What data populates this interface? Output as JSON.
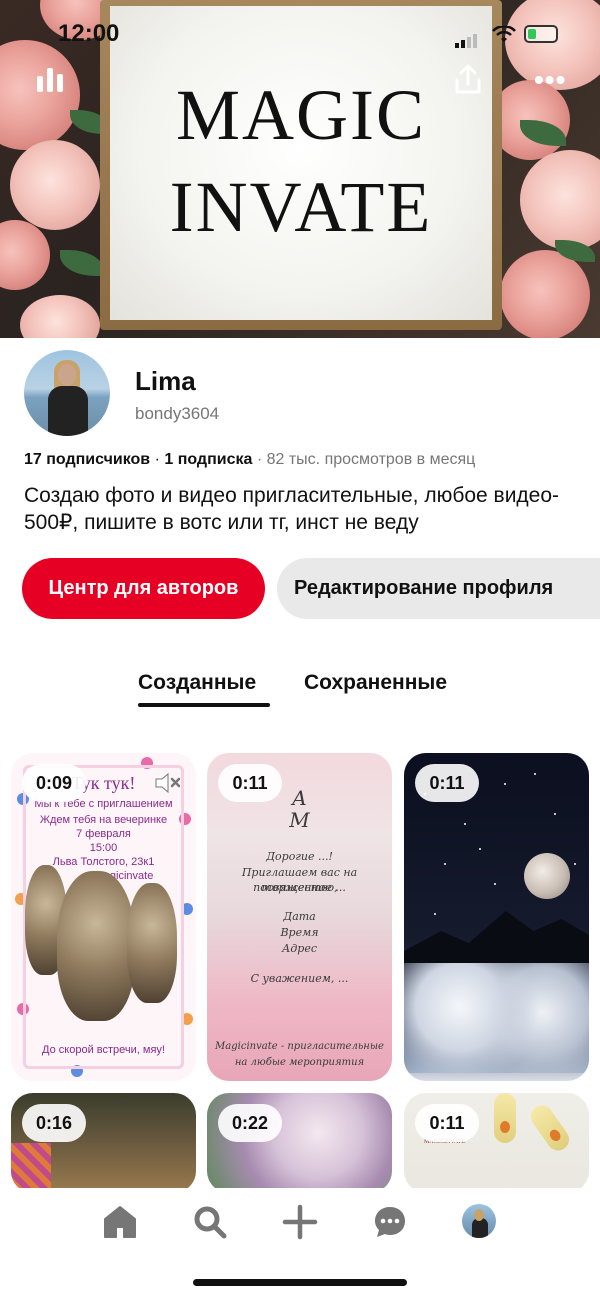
{
  "status_bar": {
    "time": "12:00"
  },
  "cover": {
    "line1": "MAGIC",
    "line2": "INVATE",
    "more_label": "•••"
  },
  "profile": {
    "name": "Lima",
    "handle": "bondy3604",
    "followers": "17 подписчиков",
    "separator1": " · ",
    "following": "1 подписка",
    "separator2": " · ",
    "monthly_views": "82 тыс. просмотров в месяц",
    "bio": "Создаю фото и видео пригласительные, любое видео- 500₽, пишите в вотс или тг, инст не веду"
  },
  "buttons": {
    "creator_hub": "Центр для авторов",
    "edit_profile": "Редактирование профиля"
  },
  "tabs": {
    "created": "Созданные",
    "saved": "Сохраненные",
    "active": "created"
  },
  "pins": [
    {
      "duration": "0:09",
      "muted": true,
      "text": {
        "title": "Тук тук!",
        "l1": "Мы к тебе с приглашением",
        "l2": "Ждем тебя на вечеринке",
        "l3": "7 февраля",
        "l4": "15:00",
        "l5": "Льва Толстого, 23к1",
        "l6": "Magicinvate",
        "footer": "До скорой встречи, мяу!"
      }
    },
    {
      "duration": "0:11",
      "text": {
        "mono": "А\nМ",
        "l1": "Дорогие ...!",
        "l2": "Приглашаем вас на торжество,",
        "l3": "посвященное ...",
        "l4": "Дата",
        "l5": "Время",
        "l6": "Адрес",
        "l7": "С уважением, ...",
        "f1": "Magicinvate - пригласительные",
        "f2": "на любые мероприятия"
      }
    },
    {
      "duration": "0:11"
    },
    {
      "duration": "0:16"
    },
    {
      "duration": "0:22"
    },
    {
      "duration": "0:11",
      "brand": "MAGICINVATE"
    }
  ],
  "colors": {
    "accent": "#e60023",
    "secondary_button": "#e9e9e9",
    "muted_text": "#767676"
  },
  "nav": {
    "items": [
      "home-icon",
      "search-icon",
      "add-icon",
      "messages-icon",
      "profile-avatar"
    ]
  }
}
